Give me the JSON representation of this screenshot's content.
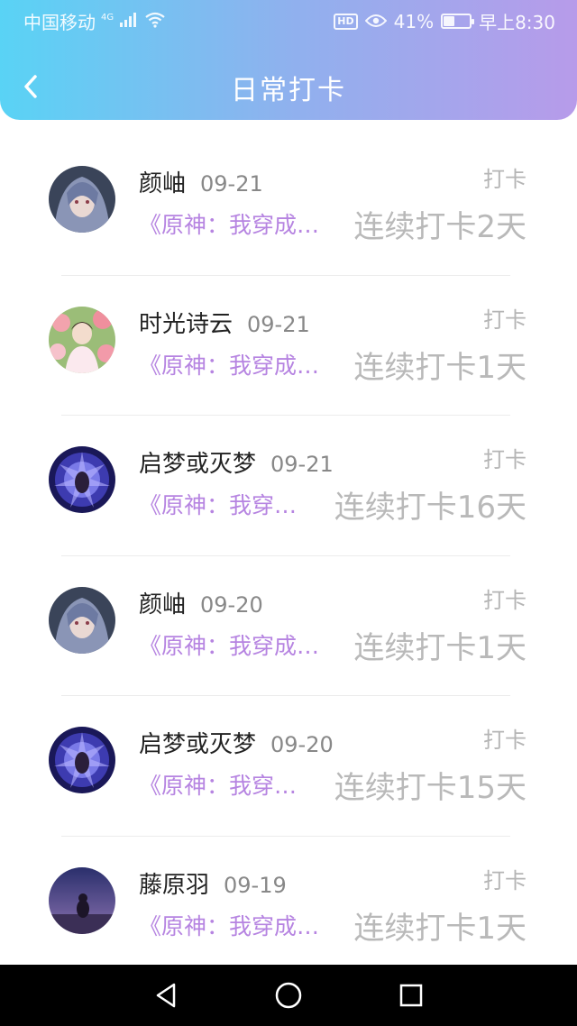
{
  "status_bar": {
    "carrier": "中国移动",
    "network": "4G",
    "hd": "HD",
    "battery_percent": "41%",
    "battery_level": 0.41,
    "time": "早上8:30"
  },
  "header": {
    "title": "日常打卡"
  },
  "items": [
    {
      "name": "颜岫",
      "date": "09-21",
      "tag": "打卡",
      "book": "《原神：我穿成…",
      "streak": "连续打卡2天",
      "avatar": "anime-boy-avatar"
    },
    {
      "name": "时光诗云",
      "date": "09-21",
      "tag": "打卡",
      "book": "《原神：我穿成…",
      "streak": "连续打卡1天",
      "avatar": "flower-girl-avatar"
    },
    {
      "name": "启梦或灭梦",
      "date": "09-21",
      "tag": "打卡",
      "book": "《原神：我穿…",
      "streak": "连续打卡16天",
      "avatar": "power-aura-avatar"
    },
    {
      "name": "颜岫",
      "date": "09-20",
      "tag": "打卡",
      "book": "《原神：我穿成…",
      "streak": "连续打卡1天",
      "avatar": "anime-boy-avatar"
    },
    {
      "name": "启梦或灭梦",
      "date": "09-20",
      "tag": "打卡",
      "book": "《原神：我穿…",
      "streak": "连续打卡15天",
      "avatar": "power-aura-avatar"
    },
    {
      "name": "藤原羽",
      "date": "09-19",
      "tag": "打卡",
      "book": "《原神：我穿成…",
      "streak": "连续打卡1天",
      "avatar": "night-sky-avatar"
    }
  ],
  "colors": {
    "header_gradient": [
      "#59d3f5",
      "#b79bea"
    ],
    "book_title": "#b684e1",
    "streak": "#b9b9b9"
  }
}
